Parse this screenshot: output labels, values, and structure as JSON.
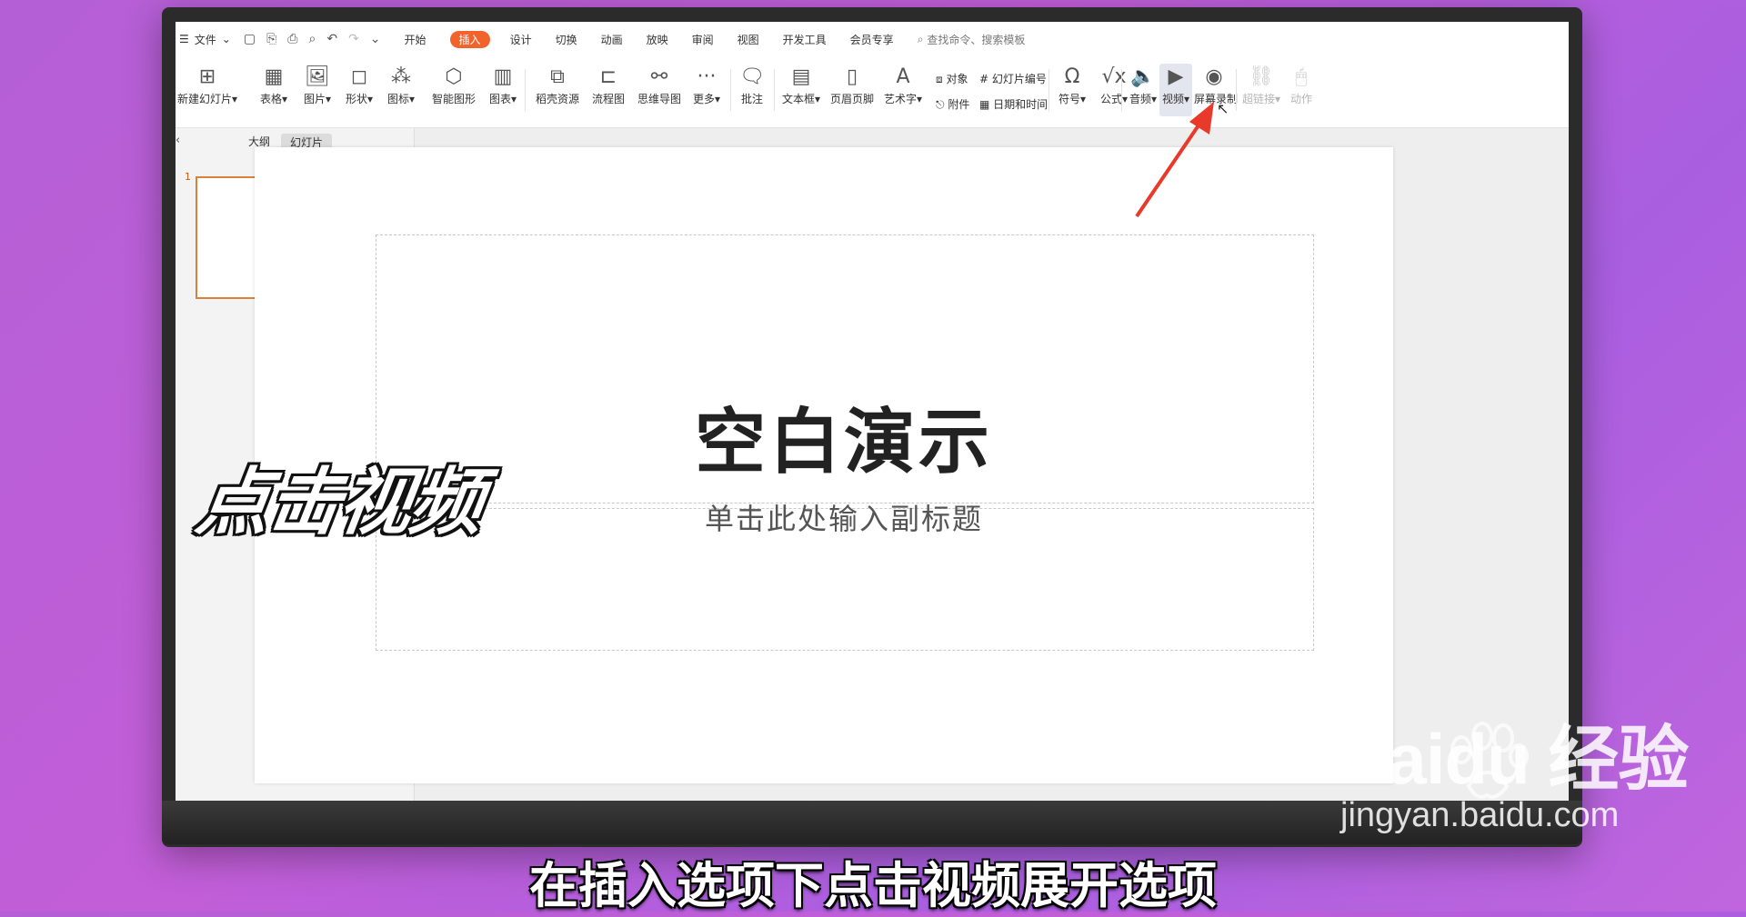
{
  "menubar": {
    "file_label": "文件",
    "tabs": [
      "开始",
      "插入",
      "设计",
      "切换",
      "动画",
      "放映",
      "审阅",
      "视图",
      "开发工具",
      "会员专享"
    ],
    "active_tab": "插入",
    "search_placeholder": "查找命令、搜索模板"
  },
  "ribbon": {
    "new_slide": "新建幻灯片",
    "table": "表格",
    "picture": "图片",
    "shape": "形状",
    "icon": "图标",
    "smart_graphic": "智能图形",
    "chart": "图表",
    "resources": "稻壳资源",
    "flowchart": "流程图",
    "mindmap": "思维导图",
    "more": "更多",
    "comment": "批注",
    "textbox": "文本框",
    "header_footer": "页眉页脚",
    "wordart": "艺术字",
    "object": "对象",
    "slide_number": "幻灯片编号",
    "attachment": "附件",
    "datetime": "日期和时间",
    "symbol": "符号",
    "formula": "公式",
    "audio": "音频",
    "video": "视频",
    "screen_record": "屏幕录制",
    "hyperlink": "超链接",
    "action": "动作"
  },
  "leftpane": {
    "tab_outline": "大纲",
    "tab_slides": "幻灯片",
    "slide_number": "1"
  },
  "slide": {
    "title": "空白演示",
    "subtitle": "单击此处输入副标题"
  },
  "overlay_label": "点击视频",
  "caption": "在插入选项下点击视频展开选项",
  "watermark": {
    "brand": "Baidu 经验",
    "url": "jingyan.baidu.com"
  }
}
